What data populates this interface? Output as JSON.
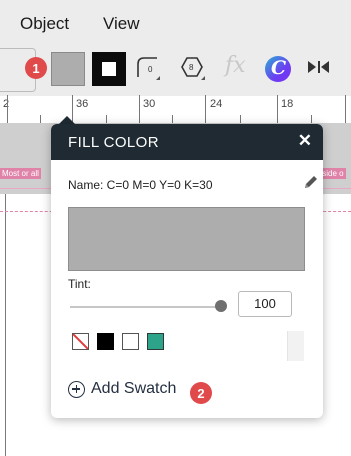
{
  "menubar": {
    "items": [
      {
        "label": "Object"
      },
      {
        "label": "View"
      }
    ]
  },
  "toolbar": {
    "badge_1": "1",
    "fill_color": "#adadad",
    "stroke_color": "#0b0b0b",
    "corner_value": "0",
    "sides_value": "8",
    "fx_label": "fx",
    "canva_label": "C"
  },
  "ruler": {
    "labels": [
      "2",
      "36",
      "30",
      "24",
      "18"
    ]
  },
  "canvas": {
    "margin_label_left": "Most or all",
    "margin_label_right": "tside o"
  },
  "fill_color_popup": {
    "title": "FILL COLOR",
    "close_symbol": "✕",
    "name_text": "Name: C=0 M=0 Y=0 K=30",
    "preview_color": "#adadad",
    "tint_label": "Tint:",
    "tint_value": "100",
    "tint_fraction": 1.0,
    "swatches": [
      {
        "name": "none",
        "color": "none"
      },
      {
        "name": "black",
        "color": "#000000"
      },
      {
        "name": "white",
        "color": "#ffffff"
      },
      {
        "name": "green",
        "color": "#2da48a"
      }
    ],
    "add_swatch_label": "Add Swatch",
    "badge_2": "2"
  }
}
